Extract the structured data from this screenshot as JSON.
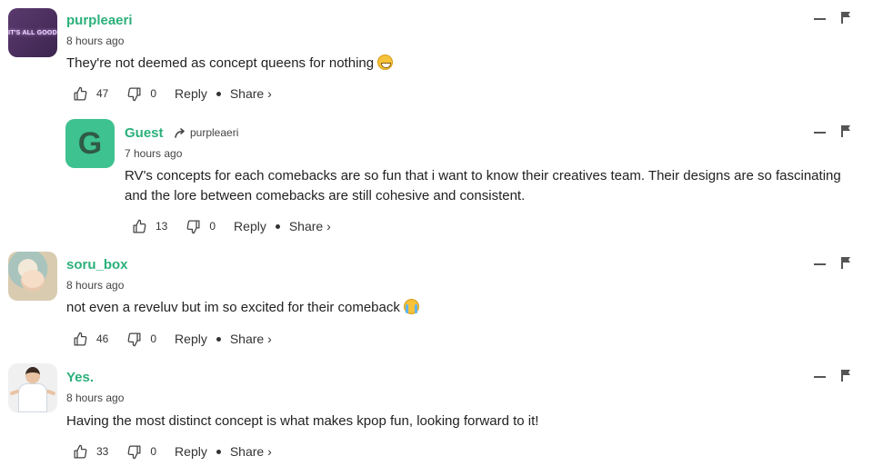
{
  "comments": [
    {
      "username": "purpleaeri",
      "avatar_text": "IT'S ALL GOOD",
      "time": "8 hours ago",
      "text": "They're not deemed as concept queens for nothing",
      "emoji": "grinning-face-icon",
      "likes": "47",
      "dislikes": "0",
      "reply_label": "Reply",
      "share_label": "Share ›"
    },
    {
      "username": "Guest",
      "avatar_letter": "G",
      "reply_to": "purpleaeri",
      "time": "7 hours ago",
      "text_line1": "RV's concepts for each comebacks are so fun that i want to know their creatives team. Their designs are so fascinating",
      "text_line2": "and the lore between comebacks are still cohesive and consistent.",
      "likes": "13",
      "dislikes": "0",
      "reply_label": "Reply",
      "share_label": "Share ›"
    },
    {
      "username": "soru_box",
      "time": "8 hours ago",
      "text": "not even a reveluv but im so excited for their comeback",
      "emoji": "crying-face-icon",
      "likes": "46",
      "dislikes": "0",
      "reply_label": "Reply",
      "share_label": "Share ›"
    },
    {
      "username": "Yes.",
      "time": "8 hours ago",
      "text": "Having the most distinct concept is what makes kpop fun, looking forward to it!",
      "likes": "33",
      "dislikes": "0",
      "reply_label": "Reply",
      "share_label": "Share ›"
    }
  ],
  "colors": {
    "username": "#2bb07a",
    "guest_avatar": "#3ec28f",
    "text": "#222222"
  }
}
